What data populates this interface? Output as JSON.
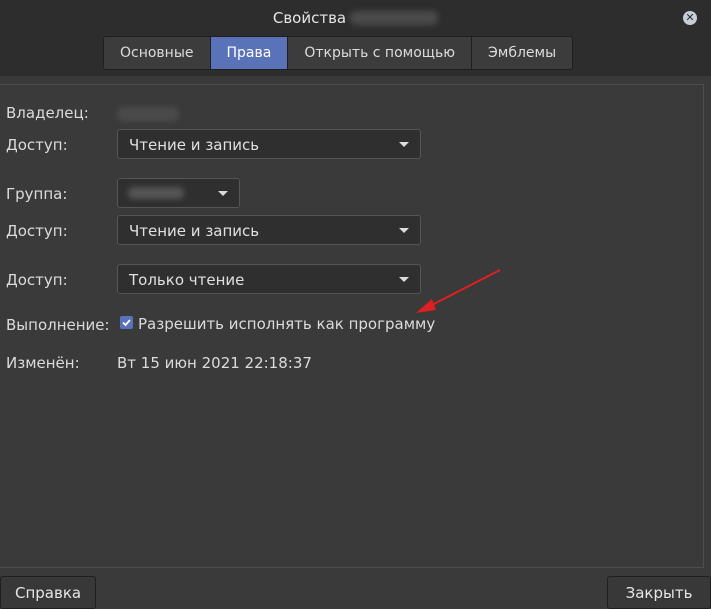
{
  "window": {
    "title": "Свойства"
  },
  "tabs": [
    {
      "label": "Основные",
      "active": false
    },
    {
      "label": "Права",
      "active": true
    },
    {
      "label": "Открыть с помощью",
      "active": false
    },
    {
      "label": "Эмблемы",
      "active": false
    }
  ],
  "permissions": {
    "owner_label": "Владелец:",
    "owner_access_label": "Доступ:",
    "owner_access_value": "Чтение и запись",
    "group_label": "Группа:",
    "group_access_label": "Доступ:",
    "group_access_value": "Чтение и запись",
    "others_access_label": "Доступ:",
    "others_access_value": "Только чтение",
    "execute_label": "Выполнение:",
    "execute_checkbox_label": "Разрешить исполнять как программу",
    "execute_checked": true,
    "modified_label": "Изменён:",
    "modified_value": "Вт 15 июн 2021 22:18:37"
  },
  "buttons": {
    "help": "Справка",
    "close": "Закрыть"
  },
  "colors": {
    "accent": "#5a72b8",
    "annotation_arrow": "#e02020"
  },
  "icons": {
    "close": "close-icon",
    "dropdown": "chevron-down-icon",
    "check": "check-icon"
  }
}
